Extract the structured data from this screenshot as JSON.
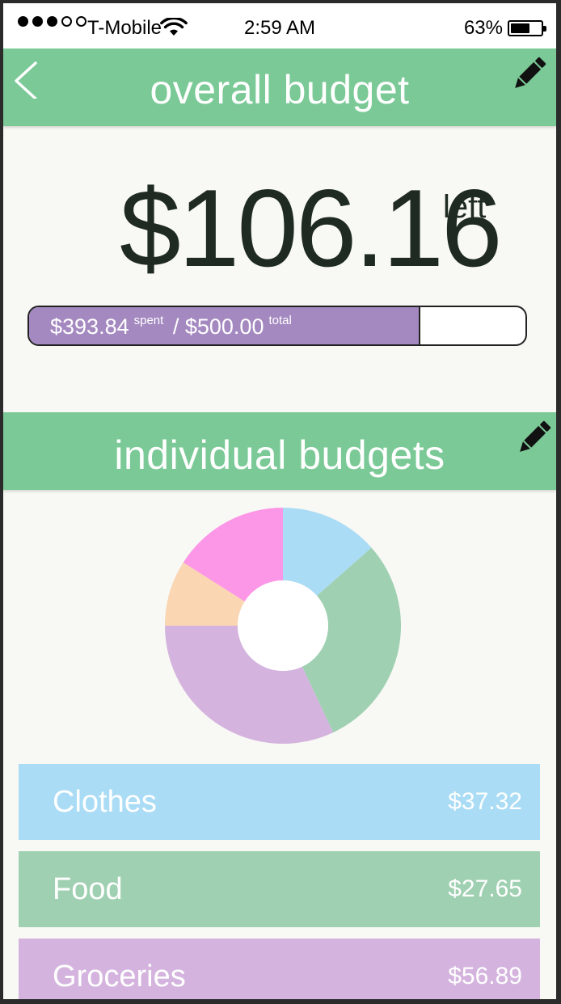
{
  "status_bar": {
    "carrier": "T-Mobile",
    "time": "2:59 AM",
    "battery_percent": "63%",
    "battery_level": 0.63,
    "signal_bars_filled": 3,
    "signal_bars_total": 5
  },
  "overall": {
    "title": "overall budget",
    "remaining_amount": "$106.16",
    "remaining_suffix": "left",
    "spent_amount": "$393.84",
    "spent_label": "spent",
    "separator": "/",
    "total_amount": "$500.00",
    "total_label": "total",
    "spent_fraction": 0.7877,
    "bar_color": "#a488c0"
  },
  "individual": {
    "title": "individual budgets",
    "segments": [
      {
        "color": "#aadcf6",
        "fraction": 0.135
      },
      {
        "color": "#a0d0b2",
        "fraction": 0.295
      },
      {
        "color": "#d4b4de",
        "fraction": 0.32
      },
      {
        "color": "#fad6b2",
        "fraction": 0.09
      },
      {
        "color": "#fc96e6",
        "fraction": 0.16
      }
    ],
    "categories": [
      {
        "label": "Clothes",
        "amount": "$37.32",
        "color": "#aadcf6"
      },
      {
        "label": "Food",
        "amount": "$27.65",
        "color": "#a0d0b2"
      },
      {
        "label": "Groceries",
        "amount": "$56.89",
        "color": "#d4b4de"
      }
    ]
  },
  "colors": {
    "header": "#7ac996",
    "background": "#f8f8f4",
    "amount_text": "#1e2a22"
  },
  "icons": {
    "back": "chevron-left-icon",
    "edit": "pencil-icon",
    "wifi": "wifi-icon",
    "battery": "battery-icon"
  }
}
